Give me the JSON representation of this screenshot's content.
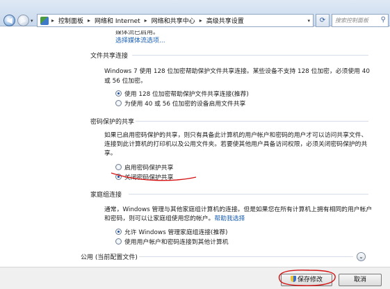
{
  "addressbar": {
    "breadcrumbs": [
      "控制面板",
      "网络和 Internet",
      "网络和共享中心",
      "高级共享设置"
    ],
    "search_placeholder": "搜索控制面板"
  },
  "content": {
    "partial_top_line": "媒体流已启用。",
    "partial_link": "选择媒体流选项...",
    "file_sharing": {
      "title": "文件共享连接",
      "description_line1": "Windows 7 使用 128 位加密帮助保护文件共享连接。某些设备不支持 128 位加密，必须使用 40",
      "description_line2": "或 56 位加密。",
      "options": [
        {
          "label": "使用 128 位加密帮助保护文件共享连接(推荐)",
          "selected": true
        },
        {
          "label": "为使用 40 或 56 位加密的设备启用文件共享",
          "selected": false
        }
      ]
    },
    "password_sharing": {
      "title": "密码保护的共享",
      "description_line1": "如果已启用密码保护的共享，则只有具备此计算机的用户帐户和密码的用户才可以访问共享文件、",
      "description_line2": "连接到此计算机的打印机以及公用文件夹。若要使其他用户具备访问权限，必须关闭密码保护的共",
      "description_line3": "享。",
      "options": [
        {
          "label": "启用密码保护共享",
          "selected": false
        },
        {
          "label": "关闭密码保护共享",
          "selected": true
        }
      ]
    },
    "homegroup": {
      "title": "家庭组连接",
      "description_line1": "通常，Windows 管理与其他家庭组计算机的连接。但是如果您在所有计算机上拥有相同的用户帐户",
      "description_line2_prefix": "和密码，则可以让家庭组使用您的帐户。",
      "description_link": "帮助我选择",
      "options": [
        {
          "label": "允许 Windows 管理家庭组连接(推荐)",
          "selected": true
        },
        {
          "label": "使用用户帐户和密码连接到其他计算机",
          "selected": false
        }
      ]
    },
    "public_profile": {
      "title": "公用 (当前配置文件)"
    }
  },
  "buttons": {
    "save": "保存修改",
    "cancel": "取消"
  },
  "colors": {
    "link": "#1a5fb4",
    "annotation": "#d41010"
  },
  "icons": {
    "back": "arrow-left-icon",
    "forward": "arrow-right-icon",
    "refresh": "refresh-icon",
    "search": "magnifier-icon",
    "expand": "chevron-down-icon",
    "admin": "uac-shield-icon"
  }
}
